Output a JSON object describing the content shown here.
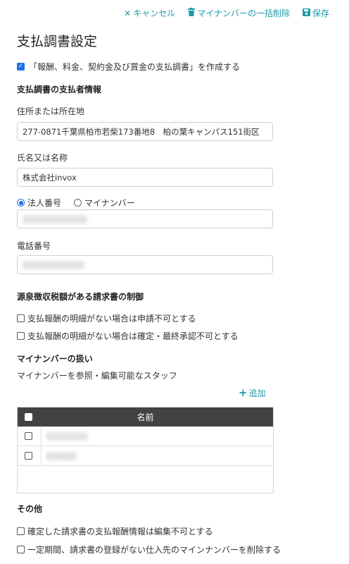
{
  "toolbar": {
    "cancel_label": "キャンセル",
    "bulk_delete_label": "マイナンバーの一括削除",
    "save_label": "保存"
  },
  "page_title": "支払調書設定",
  "create_statement_label": "「報酬、料金、契約金及び賞金の支払調書」を作成する",
  "payer_section": {
    "title": "支払調書の支払者情報",
    "address_label": "住所または所在地",
    "address_value": "277-0871千葉県柏市若柴173番地8　柏の葉キャンパス151街区",
    "name_label": "氏名又は名称",
    "name_value": "株式会社invox",
    "radio_corporate": "法人番号",
    "radio_mynumber": "マイナンバー",
    "phone_label": "電話番号"
  },
  "withholding_section": {
    "title": "源泉徴収税額がある請求書の制御",
    "option1": "支払報酬の明細がない場合は申請不可とする",
    "option2": "支払報酬の明細がない場合は確定・最終承認不可とする"
  },
  "mynumber_section": {
    "title": "マイナンバーの扱い",
    "staff_label": "マイナンバーを参照・編集可能なスタッフ",
    "add_label": "追加",
    "table_header_name": "名前"
  },
  "other_section": {
    "title": "その他",
    "option1": "確定した請求書の支払報酬情報は編集不可とする",
    "option2": "一定期間、請求書の登録がない仕入先のマインナンバーを削除する"
  },
  "colors": {
    "accent": "#1b9aa8",
    "checkbox_blue": "#1a73e8",
    "table_header_bg": "#424242"
  }
}
